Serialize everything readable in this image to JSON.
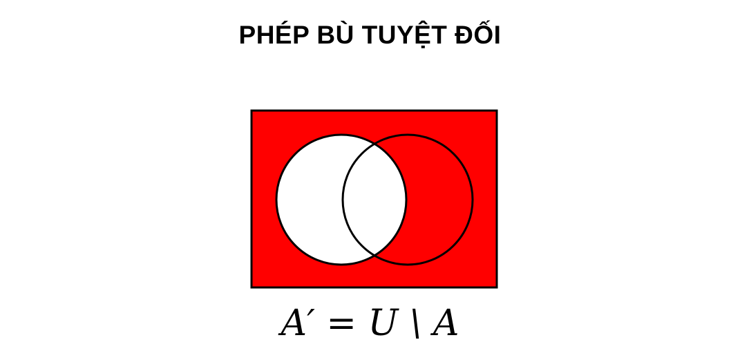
{
  "title": "PHÉP BÙ TUYỆT ĐỐI",
  "formula": "A′ = U \\ A",
  "colors": {
    "universe_fill": "#ff0000",
    "set_a_fill": "#ffffff",
    "set_b_fill": "#ff0000",
    "outline": "#000000"
  }
}
